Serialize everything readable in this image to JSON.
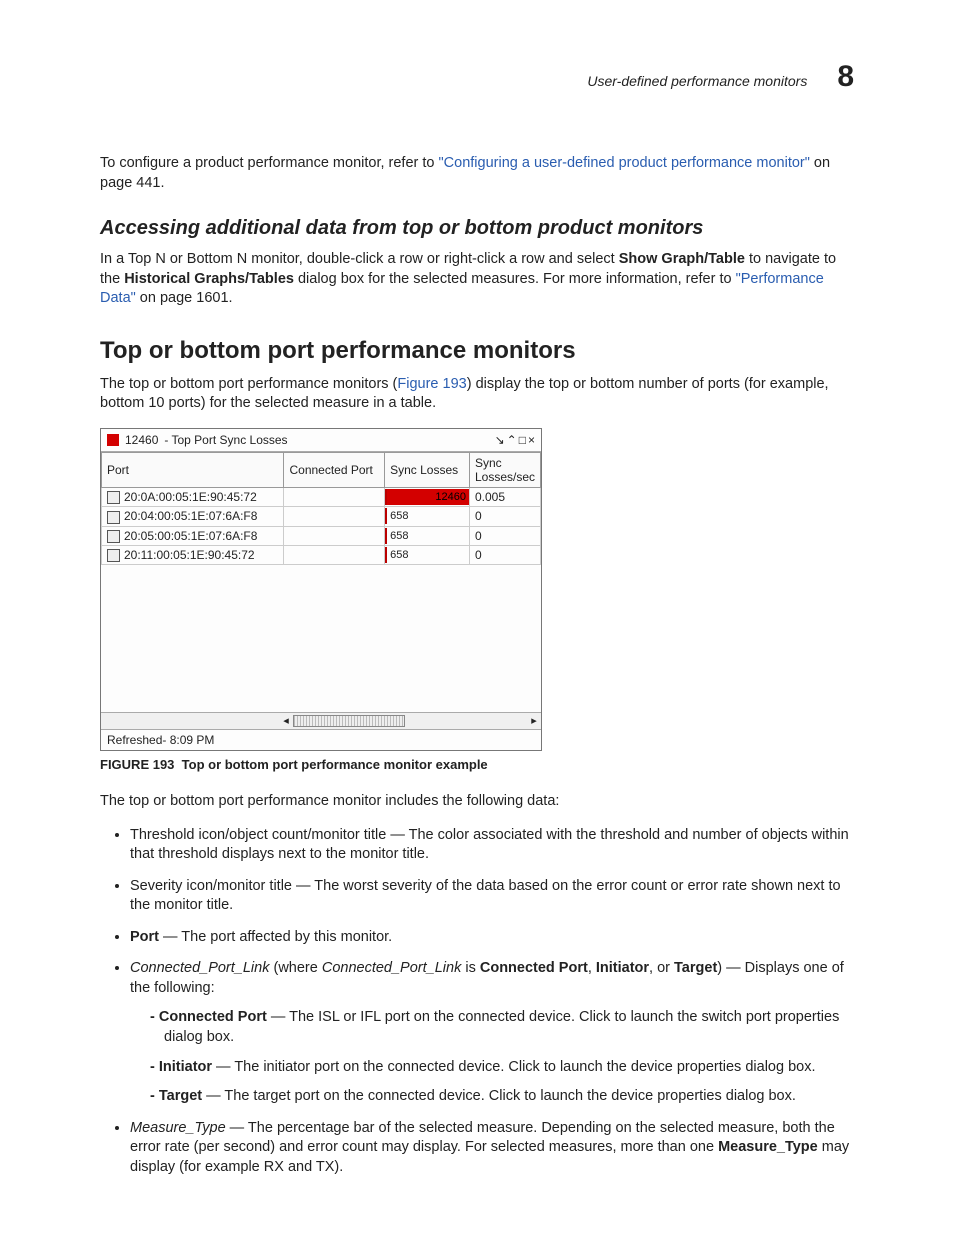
{
  "header": {
    "running_title": "User-defined performance monitors",
    "chapter_number": "8"
  },
  "intro": {
    "pre_link": "To configure a product performance monitor, refer to ",
    "link_text": "\"Configuring a user-defined product performance monitor\"",
    "post_link": " on page 441."
  },
  "subsection": {
    "title": "Accessing additional data from top or bottom product monitors",
    "p1a": "In a Top N or Bottom N monitor, double-click a row or right-click a row and select ",
    "p1_bold1": "Show Graph/Table",
    "p1b": " to navigate to the ",
    "p1_bold2": "Historical Graphs/Tables",
    "p1c": " dialog box for the selected measures. For more information, refer to ",
    "p1_link": "\"Performance Data\"",
    "p1d": " on page 1601."
  },
  "section": {
    "title": "Top or bottom port performance monitors",
    "intro_a": "The top or bottom port performance monitors (",
    "intro_link": "Figure 193",
    "intro_b": ") display the top or bottom number of ports (for example, bottom 10 ports) for the selected measure in a table."
  },
  "figure": {
    "title_count": "12460",
    "title_text": "- Top Port Sync Losses",
    "columns": [
      "Port",
      "Connected Port",
      "Sync Losses",
      "Sync Losses/sec"
    ],
    "rows": [
      {
        "port": "20:0A:00:05:1E:90:45:72",
        "conn": "",
        "sync": "12460",
        "rate": "0.005",
        "full": true
      },
      {
        "port": "20:04:00:05:1E:07:6A:F8",
        "conn": "",
        "sync": "658",
        "rate": "0",
        "full": false
      },
      {
        "port": "20:05:00:05:1E:07:6A:F8",
        "conn": "",
        "sync": "658",
        "rate": "0",
        "full": false
      },
      {
        "port": "20:11:00:05:1E:90:45:72",
        "conn": "",
        "sync": "658",
        "rate": "0",
        "full": false
      }
    ],
    "footer": "Refreshed- 8:09 PM",
    "caption_label": "FIGURE 193",
    "caption_text": "Top or bottom port performance monitor example"
  },
  "after_fig": "The top or bottom port performance monitor includes the following data:",
  "bullets": {
    "b1": "Threshold icon/object count/monitor title — The color associated with the threshold and number of objects within that threshold displays next to the monitor title.",
    "b2": "Severity icon/monitor title — The worst severity of the data based on the error count or error rate shown next to the monitor title.",
    "b3_bold": "Port",
    "b3": " — The port affected by this monitor.",
    "b4_i1": "Connected_Port_Link",
    "b4_mid": " (where ",
    "b4_i2": "Connected_Port_Link",
    "b4_mid2": " is ",
    "b4_b1": "Connected Port",
    "b4_comma": ", ",
    "b4_b2": "Initiator",
    "b4_or": ", or ",
    "b4_b3": "Target",
    "b4_end": ") — Displays one of the following:",
    "d1_b": "Connected Port",
    "d1": " — The ISL or IFL port on the connected device. Click to launch the switch port properties dialog box.",
    "d2_b": "Initiator",
    "d2": " — The initiator port on the connected device. Click to launch the device properties dialog box.",
    "d3_b": "Target",
    "d3": " — The target port on the connected device. Click to launch the device properties dialog box.",
    "b5_i": "Measure_Type",
    "b5a": " — The percentage bar of the selected measure. Depending on the selected measure, both the error rate (per second) and error count may display. For selected measures, more than one ",
    "b5_b": "Measure_Type",
    "b5b": " may display (for example RX and TX)."
  }
}
